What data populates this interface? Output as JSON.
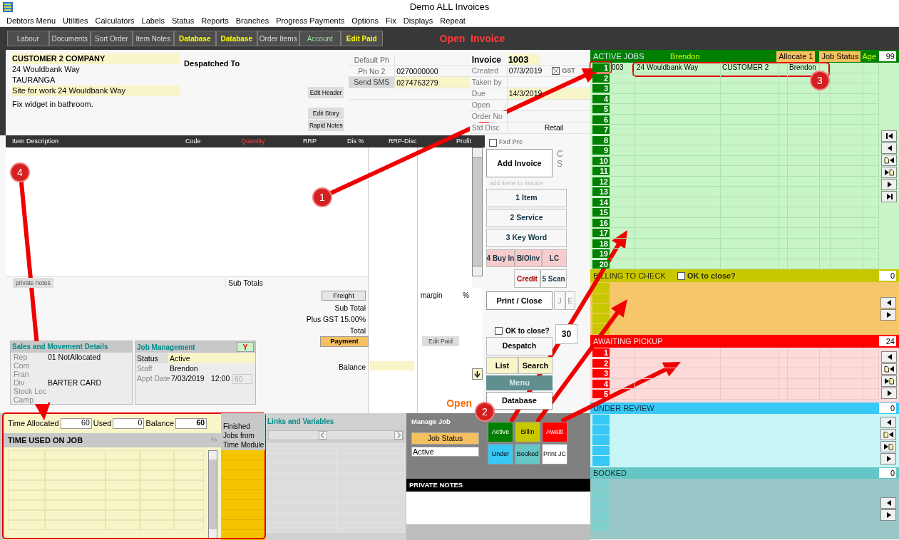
{
  "window": {
    "title": "Demo ALL Invoices"
  },
  "menu": [
    "Debtors Menu",
    "Utilities",
    "Calculators",
    "Labels",
    "Status",
    "Reports",
    "Branches",
    "Progress Payments",
    "Options",
    "Fix",
    "Displays",
    "Repeat"
  ],
  "tabs": [
    {
      "label": "Labour",
      "kind": "plain"
    },
    {
      "label": "Documents",
      "kind": "plain"
    },
    {
      "label": "Sort Order",
      "kind": "plain"
    },
    {
      "label": "Item Notes",
      "kind": "plain"
    },
    {
      "label": "Database",
      "kind": "highlight"
    },
    {
      "label": "Database",
      "kind": "highlight"
    },
    {
      "label": "Order Items",
      "kind": "plain"
    },
    {
      "label": "Account",
      "kind": "account"
    },
    {
      "label": "Edit Paid",
      "kind": "highlight"
    }
  ],
  "mode": "Open  Invoice",
  "customer": {
    "name": "CUSTOMER 2 COMPANY",
    "address": "24 Wouldbank Way",
    "city": "TAURANGA",
    "site": "Site for work 24 Wouldbank Way",
    "story": "Fix widget in bathroom."
  },
  "despatched_to": "Despatched To",
  "header_buttons": [
    "Edit Header",
    "Edit Story",
    "Rapid Notes"
  ],
  "phones": [
    {
      "kind": "label",
      "label": "Default Ph"
    },
    {
      "kind": "label",
      "label": "Ph No 2",
      "value": "0270000000"
    },
    {
      "kind": "button",
      "label": "Send SMS",
      "value": "0274763279"
    }
  ],
  "invoice": {
    "label": "Invoice",
    "number": "1003",
    "gst": {
      "label": "GST",
      "checked": true
    },
    "fields": [
      {
        "label": "Created",
        "value": "07/3/2019",
        "highlight": false
      },
      {
        "label": "Taken by",
        "highlight": false
      },
      {
        "label": "Due",
        "value": "14/3/2019",
        "highlight": true
      },
      {
        "label": "Open",
        "highlight": false
      },
      {
        "label": "Order No",
        "highlight": false
      },
      {
        "label": "Std Disc",
        "value": "Retail",
        "highlight": false
      }
    ]
  },
  "items": {
    "columns": [
      {
        "label": "Item Description",
        "alert": false
      },
      {
        "label": "Code",
        "alert": false
      },
      {
        "label": "Quantity",
        "alert": true
      },
      {
        "label": "RRP",
        "alert": false
      },
      {
        "label": "Dis %",
        "alert": false
      },
      {
        "label": "RRP-Disc",
        "alert": false
      },
      {
        "label": "Profit",
        "alert": false
      }
    ],
    "private_notes": "private notes",
    "subtotals": "Sub Totals"
  },
  "totals": {
    "freight": "Freight",
    "rows": [
      "Sub Total",
      "Plus GST 15.00%",
      "Total"
    ],
    "payment": "Payment",
    "balance": "Balance",
    "margin": "margin",
    "percent": "%",
    "edit_paid": "Edit Paid",
    "status": "Open"
  },
  "sales": {
    "title": "Sales and Movement Details",
    "fields": [
      {
        "label": "Rep",
        "value": "01 NotAllocated"
      },
      {
        "label": "Com"
      },
      {
        "label": "Fran"
      },
      {
        "label": "Div",
        "value": "BARTER CARD"
      },
      {
        "label": "Stock Loc"
      },
      {
        "label": "Camp"
      }
    ]
  },
  "job_management": {
    "title": "Job Management",
    "flag": "Y",
    "status_label": "Status",
    "status": "Active",
    "staff_label": "Staff",
    "staff": "Brendon",
    "appt_label": "Appt Date",
    "appt_date": "7/03/2019",
    "appt_time": "12:00",
    "duration": "60"
  },
  "actions": {
    "fixed_price": {
      "label": "Fxd Prc",
      "checked": false
    },
    "add_invoice": "Add Invoice",
    "cs": [
      "C",
      "S"
    ],
    "hint": "add items to invoice",
    "item_buttons": [
      "1 Item",
      "2 Service",
      "3 Key Word"
    ],
    "buy_buttons": [
      "4 Buy In",
      "BIOInv",
      "LC"
    ],
    "credit": "Credit",
    "scan": "5 Scan",
    "print_close": "Print / Close",
    "print_extra": [
      "J",
      "E"
    ],
    "ok_to_close": {
      "label": "OK to close?",
      "checked": false
    },
    "count": "30",
    "despatch": "Despatch",
    "list": "List",
    "search": "Search",
    "menu": "Menu",
    "database": "Database"
  },
  "time": {
    "allocated_label": "Time Allocated",
    "allocated": "60",
    "used_label": "Used",
    "used": "0",
    "balance_label": "Balance",
    "balance": "60",
    "title": "TIME USED ON JOB",
    "percent": "%",
    "finished": "Finished Jobs from Time Module"
  },
  "links": {
    "title": "Links and Variables"
  },
  "manage_job": {
    "title": "Manage Job",
    "job_status": "Job Status",
    "status": "Active",
    "notes_title": "PRIVATE NOTES",
    "buttons": [
      {
        "label": "Active",
        "kind": "active"
      },
      {
        "label": "Billin",
        "kind": "billing"
      },
      {
        "label": "Awaiti",
        "kind": "awaiting"
      },
      {
        "label": "Under",
        "kind": "review"
      },
      {
        "label": "Booked",
        "kind": "booked"
      },
      {
        "label": "Print JC",
        "kind": "print"
      }
    ]
  },
  "sections": [
    {
      "kind": "active",
      "title": "ACTIVE JOBS",
      "staff": "Brendon",
      "allocate": "Allocate 1",
      "job_status": "Job Status",
      "age_label": "Age",
      "age": "99",
      "nav": [
        {
          "kind": "first"
        },
        {
          "kind": "prev"
        },
        {
          "kind": "docprev"
        },
        {
          "kind": "nextdoc"
        },
        {
          "kind": "next"
        },
        {
          "kind": "last"
        }
      ],
      "rows": [
        {
          "number": "1",
          "cells": [
            "003",
            "24 Wouldbank Way",
            "CUSTOMER 2",
            "",
            "Brendon"
          ]
        },
        {
          "number": "2"
        },
        {
          "number": "3"
        },
        {
          "number": "4"
        },
        {
          "number": "5"
        },
        {
          "number": "6"
        },
        {
          "number": "7"
        },
        {
          "number": "8"
        },
        {
          "number": "9"
        },
        {
          "number": "10"
        },
        {
          "number": "11"
        },
        {
          "number": "12"
        },
        {
          "number": "13"
        },
        {
          "number": "14"
        },
        {
          "number": "15"
        },
        {
          "number": "16"
        },
        {
          "number": "17"
        },
        {
          "number": "18"
        },
        {
          "number": "19"
        },
        {
          "number": "20"
        }
      ]
    },
    {
      "kind": "billing",
      "title": "BILLING TO CHECK",
      "ok": {
        "label": "OK to close?",
        "checked": false
      },
      "count": "0",
      "nav": [
        {
          "kind": "prev"
        },
        {
          "kind": "next"
        }
      ]
    },
    {
      "kind": "awaiting",
      "title": "AWAITING PICKUP",
      "count": "24",
      "nav": [
        {
          "kind": "prev"
        },
        {
          "kind": "docprev"
        },
        {
          "kind": "nextdoc"
        },
        {
          "kind": "next"
        }
      ],
      "rows": [
        {
          "number": "1"
        },
        {
          "number": "2"
        },
        {
          "number": "3"
        },
        {
          "number": "4"
        },
        {
          "number": "5"
        }
      ]
    },
    {
      "kind": "review",
      "title": "UNDER REVIEW",
      "count": "0",
      "nav": [
        {
          "kind": "prev"
        },
        {
          "kind": "docprev"
        },
        {
          "kind": "nextdoc"
        },
        {
          "kind": "next"
        }
      ]
    },
    {
      "kind": "booked",
      "title": "BOOKED",
      "count": "0",
      "nav": [
        {
          "kind": "prev"
        },
        {
          "kind": "next"
        }
      ]
    }
  ],
  "annotations": [
    {
      "label": "1"
    },
    {
      "label": "2"
    },
    {
      "label": "3"
    },
    {
      "label": "4"
    }
  ]
}
